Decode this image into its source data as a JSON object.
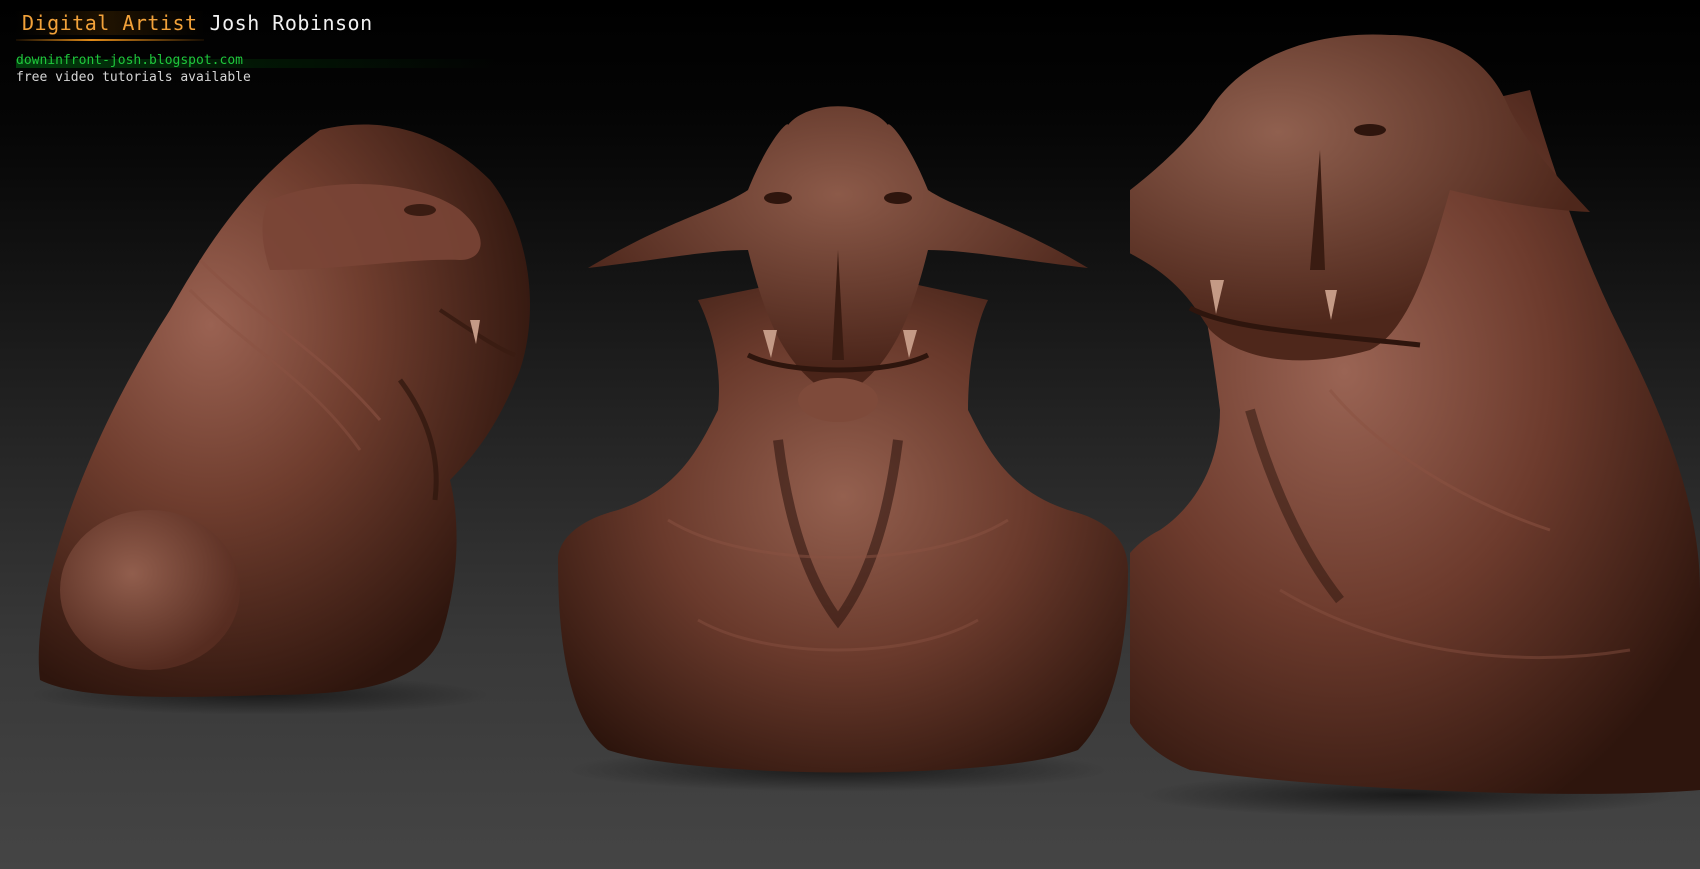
{
  "header": {
    "role": "Digital Artist",
    "name": "Josh Robinson",
    "link": "downinfront-josh.blogspot.com",
    "tagline": "free video tutorials available"
  },
  "colors": {
    "role_text": "#f2a23a",
    "name_text": "#f1f1f1",
    "link_text": "#1fc63c",
    "tagline_text": "#d6d6d6",
    "clay": "#6b3a2c",
    "clay_highlight": "#9a6252",
    "clay_shadow": "#2a130c"
  },
  "views": [
    {
      "view": "three-quarter-left"
    },
    {
      "view": "front"
    },
    {
      "view": "three-quarter-right"
    }
  ]
}
